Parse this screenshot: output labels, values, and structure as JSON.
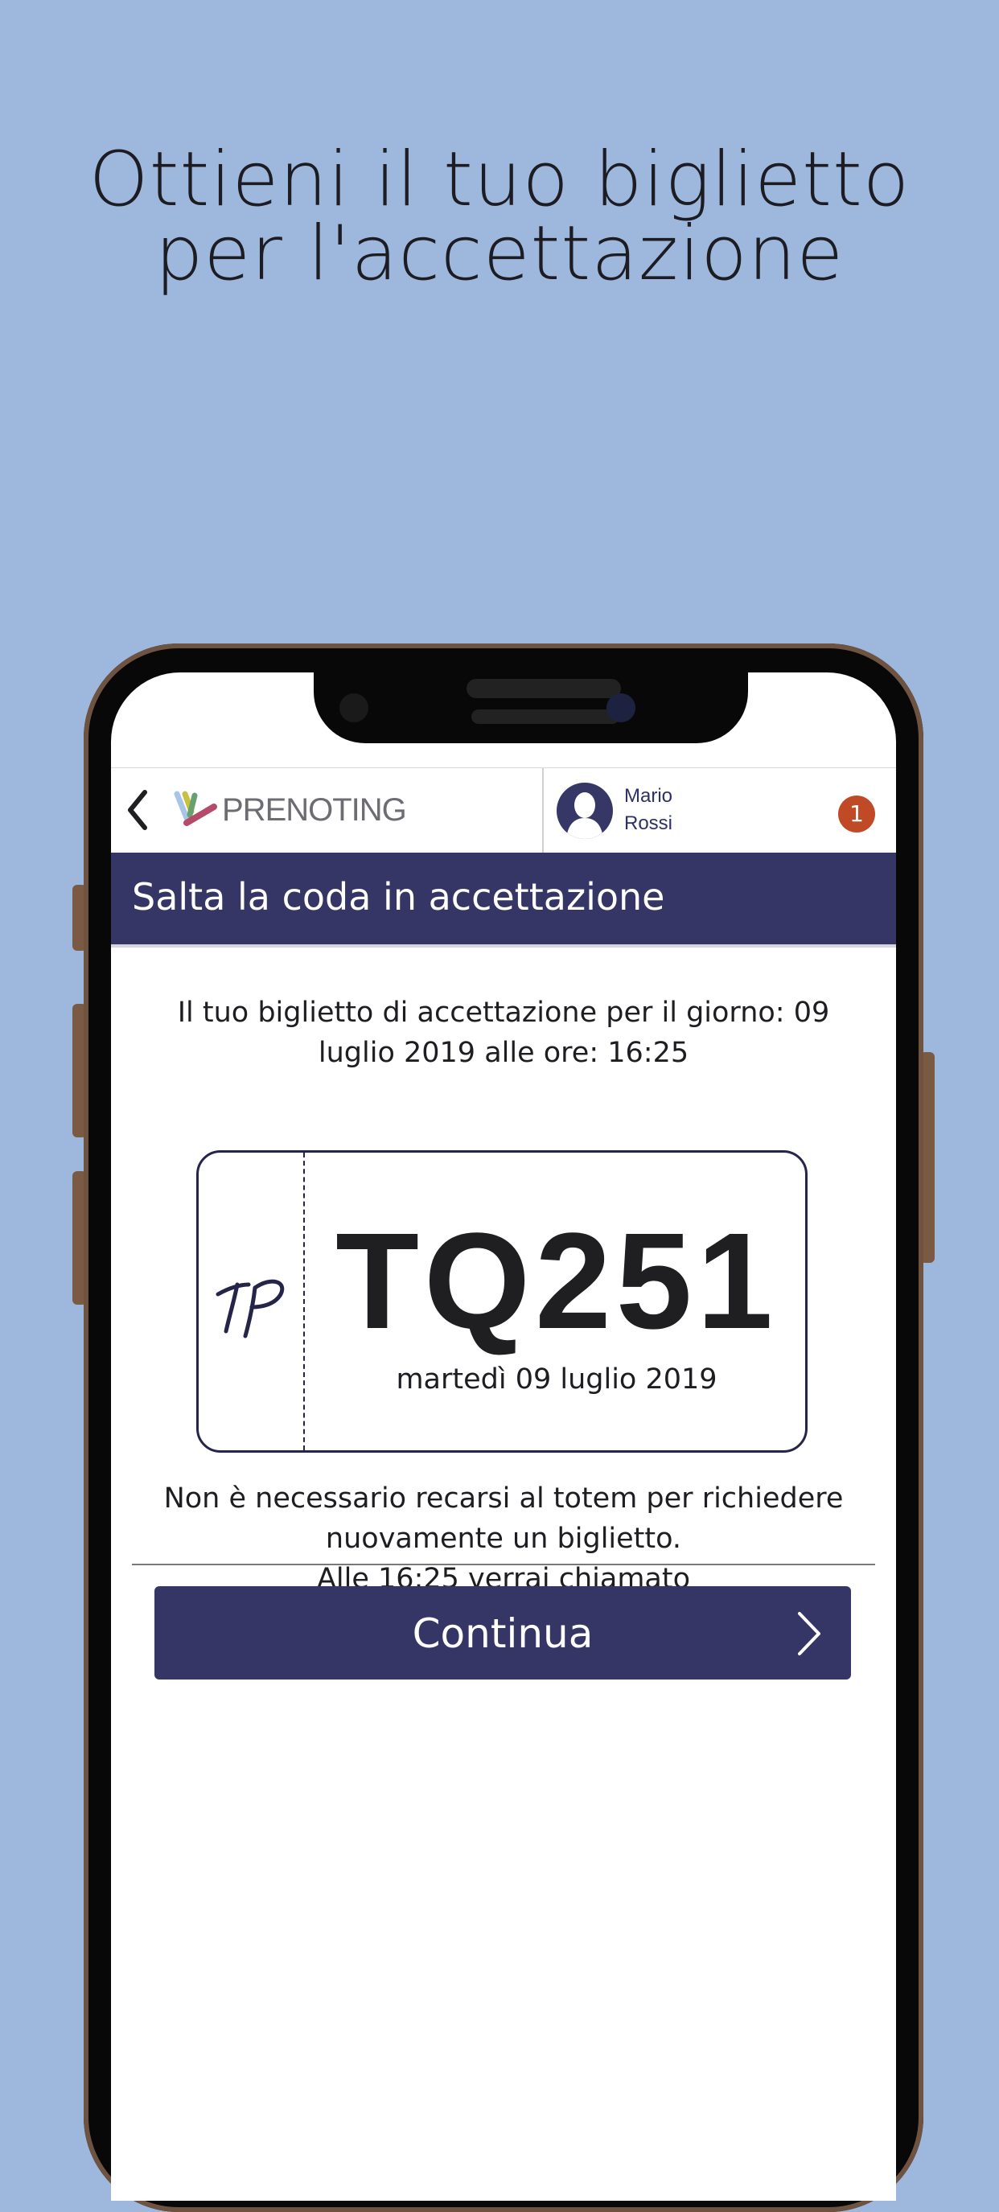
{
  "promo": {
    "title_line1": "Ottieni il tuo biglietto",
    "title_line2": "per l'accettazione"
  },
  "header": {
    "logo_text": "PRENOTING",
    "user_first_name": "Mario",
    "user_last_name": "Rossi",
    "notification_count": "1"
  },
  "section": {
    "title": "Salta la coda in accettazione"
  },
  "ticket_info": {
    "text": "Il tuo biglietto di accettazione per il giorno: 09 luglio 2019 alle ore: 16:25"
  },
  "ticket": {
    "code": "TQ251",
    "date": "martedì 09 luglio 2019"
  },
  "notice": {
    "line1": "Non è necessario recarsi al totem per richiedere",
    "line2": "nuovamente un biglietto.",
    "line3": "Alle 16:25 verrai chiamato"
  },
  "actions": {
    "continue_label": "Continua"
  },
  "colors": {
    "background": "#9eb8dd",
    "primary": "#363666",
    "badge": "#c04a25"
  },
  "icons": [
    "back-chevron-icon",
    "prenoting-logo",
    "user-avatar-icon",
    "ticket-logo-icon",
    "chevron-right-icon"
  ]
}
